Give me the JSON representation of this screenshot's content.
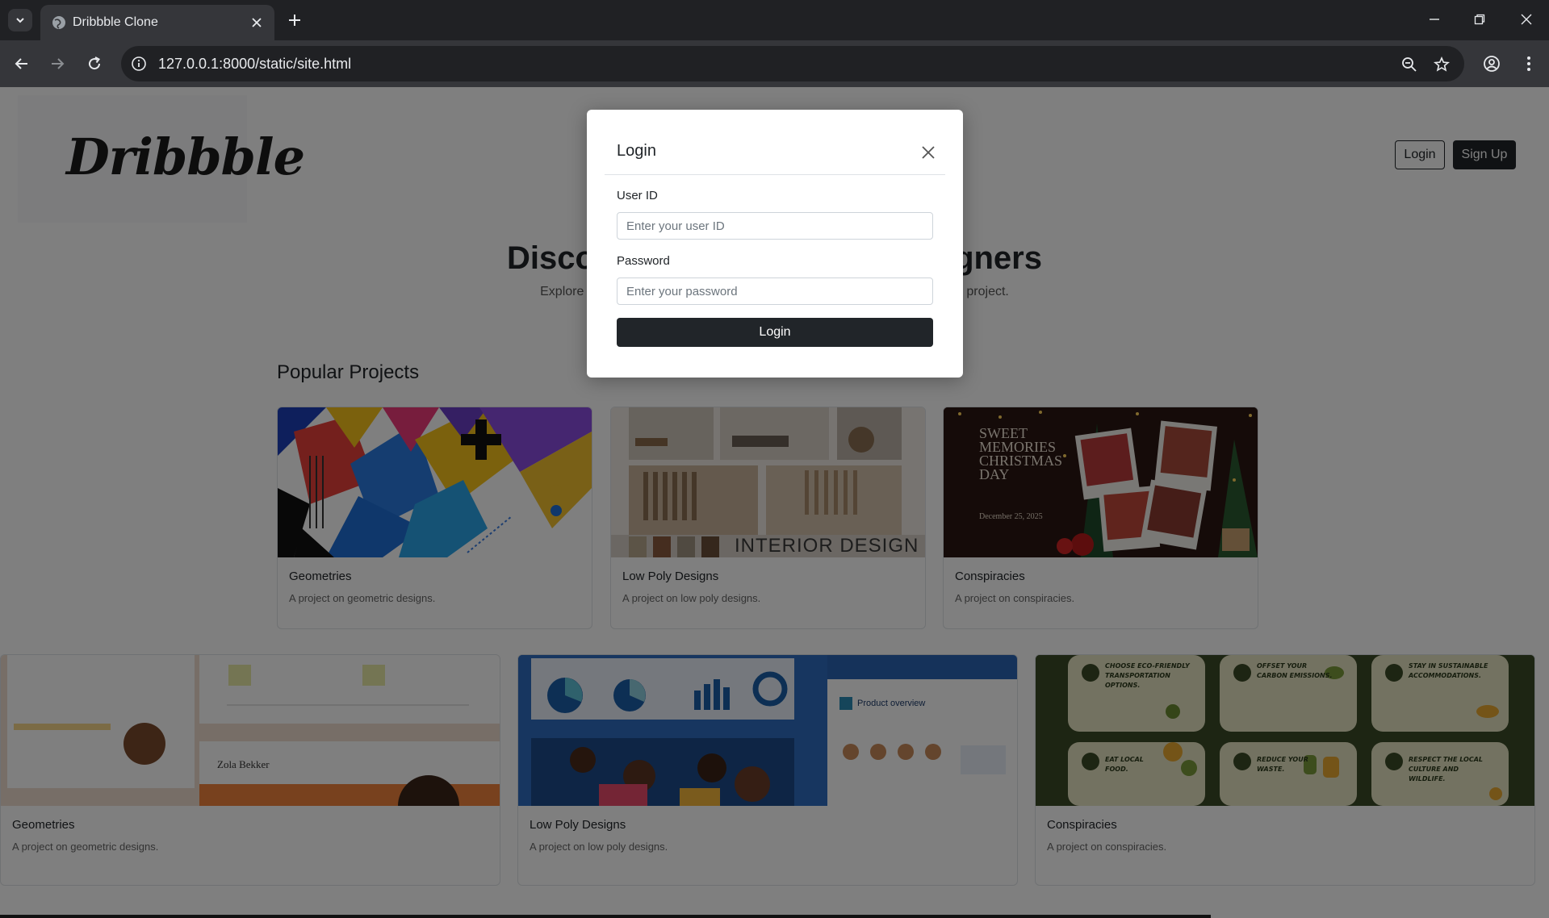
{
  "browser": {
    "tab_title": "Dribbble Clone",
    "url": "127.0.0.1:8000/static/site.html"
  },
  "header": {
    "logo": "Dribbble",
    "login_label": "Login",
    "signup_label": "Sign Up"
  },
  "hero": {
    "title": "Discover the world's top designers",
    "subtitle": "Explore work from the most talented designers, ready to take on your next project."
  },
  "popular": {
    "title": "Popular Projects",
    "row1": [
      {
        "title": "Geometries",
        "desc": "A project on geometric designs."
      },
      {
        "title": "Low Poly Designs",
        "desc": "A project on low poly designs."
      },
      {
        "title": "Conspiracies",
        "desc": "A project on conspiracies."
      }
    ],
    "row2": [
      {
        "title": "Geometries",
        "desc": "A project on geometric designs."
      },
      {
        "title": "Low Poly Designs",
        "desc": "A project on low poly designs."
      },
      {
        "title": "Conspiracies",
        "desc": "A project on conspiracies."
      }
    ]
  },
  "thumbs": {
    "interior": "INTERIOR DESIGN",
    "christmas": "SWEET MEMORIES CHRISTMAS DAY",
    "christmas_date": "December 25, 2025",
    "pres_name": "Zola Bekker",
    "product_overview": "Product overview",
    "eco_1": "CHOOSE ECO-FRIENDLY TRANSPORTATION OPTIONS.",
    "eco_2": "OFFSET YOUR CARBON EMISSIONS.",
    "eco_3": "STAY IN SUSTAINABLE ACCOMMODATIONS.",
    "eco_4": "EAT LOCAL FOOD.",
    "eco_5": "REDUCE YOUR WASTE.",
    "eco_6": "RESPECT THE LOCAL CULTURE AND WILDLIFE."
  },
  "modal": {
    "title": "Login",
    "userid_label": "User ID",
    "userid_placeholder": "Enter your user ID",
    "password_label": "Password",
    "password_placeholder": "Enter your password",
    "submit_label": "Login"
  }
}
